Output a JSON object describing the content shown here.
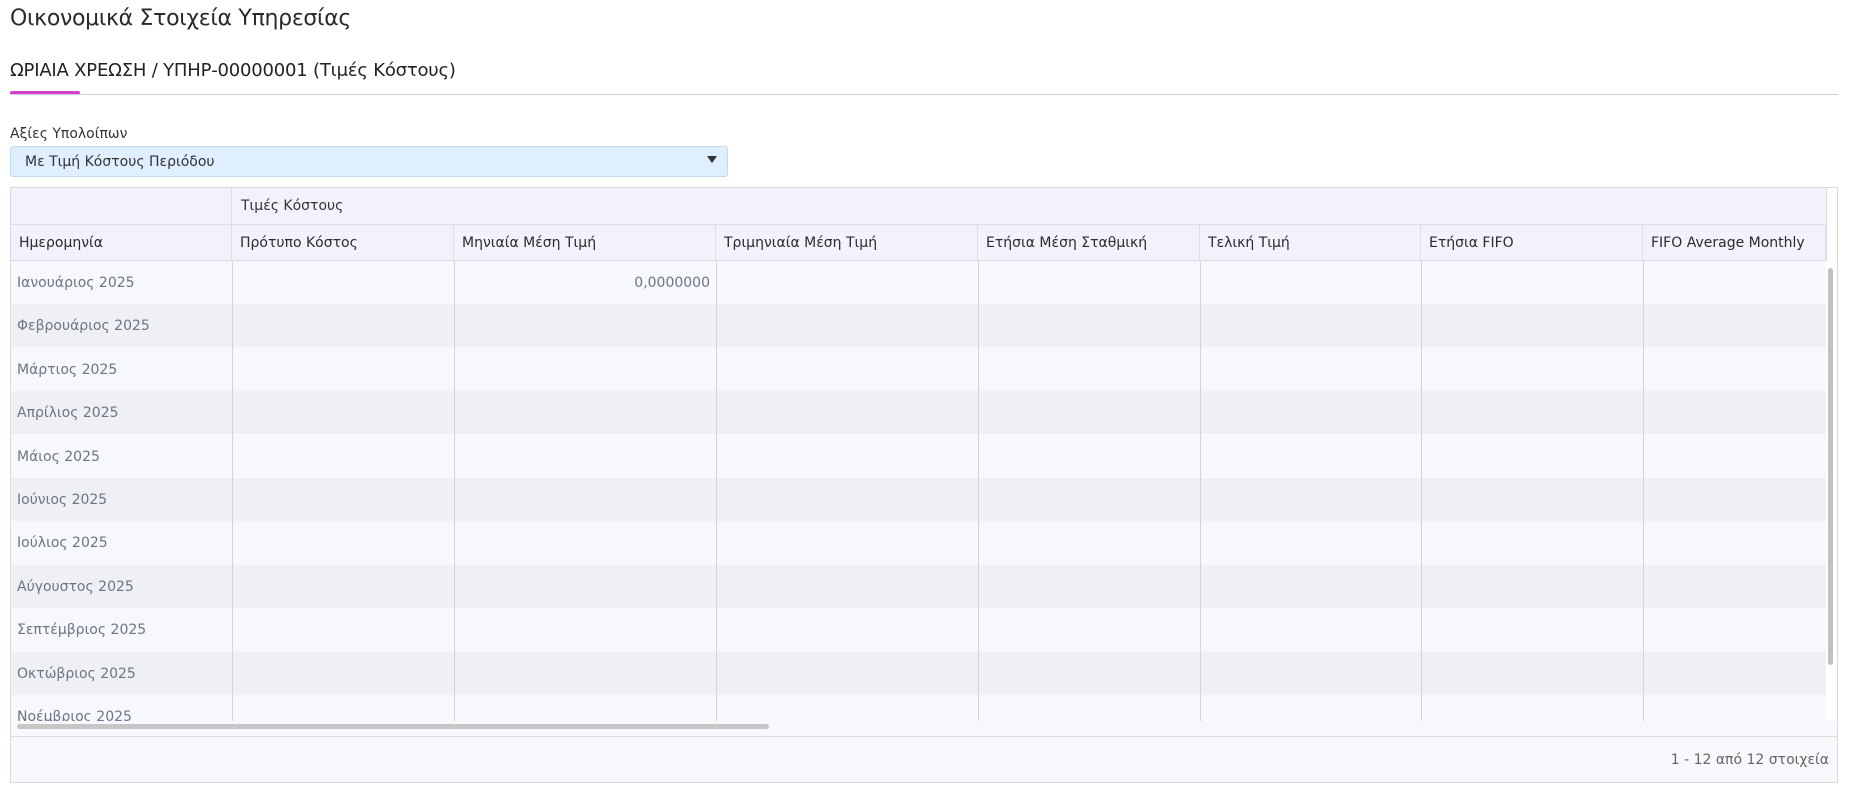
{
  "page": {
    "title": "Οικονομικά Στοιχεία Υπηρεσίας",
    "subtitle": "ΩΡΙΑΙΑ ΧΡΕΩΣΗ / ΥΠΗΡ-00000001 (Τιμές Κόστους)",
    "accent_color": "#d63ecd"
  },
  "balance_values": {
    "label": "Αξίες Υπολοίπων",
    "selected": "Με Τιμή Κόστους Περιόδου",
    "background": "#e0efff"
  },
  "grid": {
    "group_header": "Τιμές Κόστους",
    "columns": [
      "Ημερομηνία",
      "Πρότυπο Κόστος",
      "Μηνιαία Μέση Τιμή",
      "Τριμηνιαία Μέση Τιμή",
      "Ετήσια Μέση Σταθμική",
      "Τελική Τιμή",
      "Ετήσια FIFO",
      "FIFO Average Monthly"
    ],
    "rows": [
      {
        "date": "Ιανουάριος 2025",
        "standard_cost": "",
        "monthly_avg": "0,0000000",
        "quarterly_avg": "",
        "yearly_weighted": "",
        "final_price": "",
        "yearly_fifo": "",
        "fifo_avg_monthly": ""
      },
      {
        "date": "Φεβρουάριος 2025",
        "standard_cost": "",
        "monthly_avg": "",
        "quarterly_avg": "",
        "yearly_weighted": "",
        "final_price": "",
        "yearly_fifo": "",
        "fifo_avg_monthly": ""
      },
      {
        "date": "Μάρτιος 2025",
        "standard_cost": "",
        "monthly_avg": "",
        "quarterly_avg": "",
        "yearly_weighted": "",
        "final_price": "",
        "yearly_fifo": "",
        "fifo_avg_monthly": ""
      },
      {
        "date": "Απρίλιος 2025",
        "standard_cost": "",
        "monthly_avg": "",
        "quarterly_avg": "",
        "yearly_weighted": "",
        "final_price": "",
        "yearly_fifo": "",
        "fifo_avg_monthly": ""
      },
      {
        "date": "Μάιος 2025",
        "standard_cost": "",
        "monthly_avg": "",
        "quarterly_avg": "",
        "yearly_weighted": "",
        "final_price": "",
        "yearly_fifo": "",
        "fifo_avg_monthly": ""
      },
      {
        "date": "Ιούνιος 2025",
        "standard_cost": "",
        "monthly_avg": "",
        "quarterly_avg": "",
        "yearly_weighted": "",
        "final_price": "",
        "yearly_fifo": "",
        "fifo_avg_monthly": ""
      },
      {
        "date": "Ιούλιος 2025",
        "standard_cost": "",
        "monthly_avg": "",
        "quarterly_avg": "",
        "yearly_weighted": "",
        "final_price": "",
        "yearly_fifo": "",
        "fifo_avg_monthly": ""
      },
      {
        "date": "Αύγουστος 2025",
        "standard_cost": "",
        "monthly_avg": "",
        "quarterly_avg": "",
        "yearly_weighted": "",
        "final_price": "",
        "yearly_fifo": "",
        "fifo_avg_monthly": ""
      },
      {
        "date": "Σεπτέμβριος 2025",
        "standard_cost": "",
        "monthly_avg": "",
        "quarterly_avg": "",
        "yearly_weighted": "",
        "final_price": "",
        "yearly_fifo": "",
        "fifo_avg_monthly": ""
      },
      {
        "date": "Οκτώβριος 2025",
        "standard_cost": "",
        "monthly_avg": "",
        "quarterly_avg": "",
        "yearly_weighted": "",
        "final_price": "",
        "yearly_fifo": "",
        "fifo_avg_monthly": ""
      },
      {
        "date": "Νοέμβριος 2025",
        "standard_cost": "",
        "monthly_avg": "",
        "quarterly_avg": "",
        "yearly_weighted": "",
        "final_price": "",
        "yearly_fifo": "",
        "fifo_avg_monthly": ""
      }
    ]
  },
  "pager": {
    "info": "1 - 12 από 12 στοιχεία"
  }
}
